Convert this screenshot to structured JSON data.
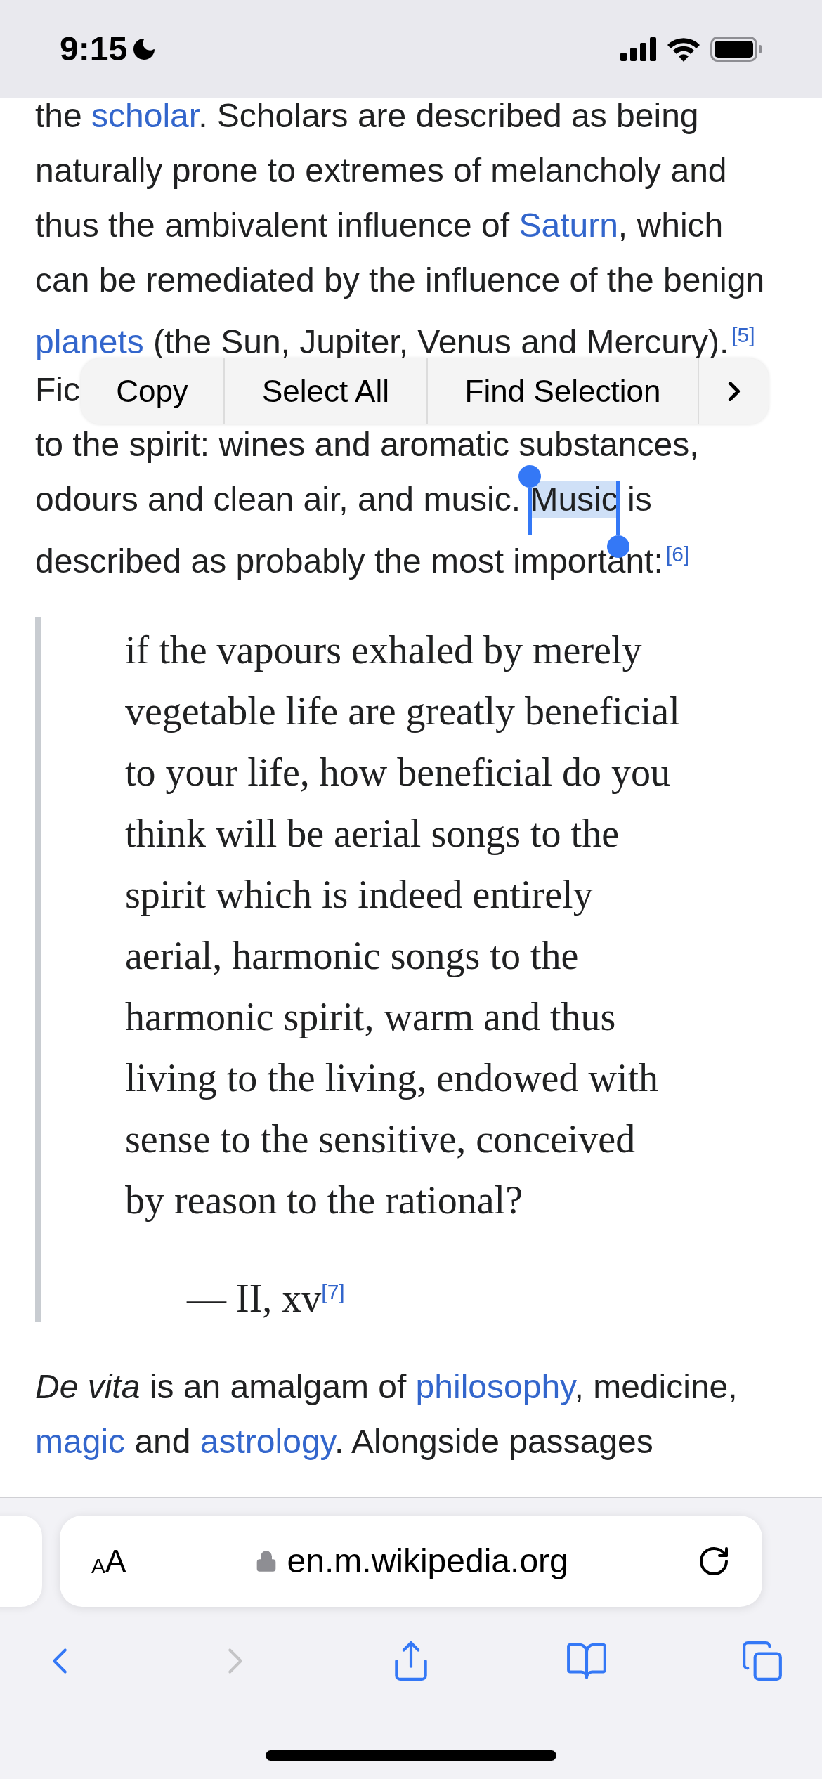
{
  "status_bar": {
    "time": "9:15"
  },
  "paragraph_1": [
    [
      {
        "kind": "text",
        "text": "the "
      },
      {
        "kind": "link",
        "text": "scholar"
      },
      {
        "kind": "text",
        "text": ". Scholars are described as being"
      }
    ],
    [
      {
        "kind": "text",
        "text": "naturally prone to extremes of melancholy and"
      }
    ],
    [
      {
        "kind": "text",
        "text": "thus the ambivalent influence of "
      },
      {
        "kind": "link",
        "text": "Saturn"
      },
      {
        "kind": "text",
        "text": ", which"
      }
    ],
    [
      {
        "kind": "text",
        "text": "can be remediated by the influence of the benign"
      }
    ],
    [
      {
        "kind": "link",
        "text": "planets"
      },
      {
        "kind": "text",
        "text": " (the Sun, Jupiter, Venus and Mercury)."
      },
      {
        "kind": "ref",
        "text": "[5]"
      }
    ],
    [
      {
        "kind": "text",
        "text": "Fic"
      }
    ],
    [
      {
        "kind": "text",
        "text": "to the spirit: wines and aromatic substances,"
      }
    ],
    [
      {
        "kind": "text",
        "text": "odours and clean air, and music. "
      },
      {
        "kind": "selected",
        "text": "Music"
      },
      {
        "kind": "text",
        "text": " is"
      }
    ],
    [
      {
        "kind": "text",
        "text": "described as probably the most important:"
      },
      {
        "kind": "ref",
        "text": "[6]"
      }
    ]
  ],
  "selection_menu": {
    "items": [
      "Copy",
      "Select All",
      "Find Selection"
    ]
  },
  "quote": {
    "lines": [
      "if the vapours exhaled by merely",
      "vegetable life are greatly beneficial",
      "to your life, how beneficial do you",
      "think will be aerial songs to the",
      "spirit which is indeed entirely",
      "aerial, harmonic songs to the",
      "harmonic spirit, warm and thus",
      "living to the living, endowed with",
      "sense to the sensitive, conceived",
      "by reason to the rational?"
    ],
    "attribution": {
      "text": "— II, xv",
      "ref": "[7]"
    }
  },
  "paragraph_2": [
    [
      {
        "kind": "italic",
        "text": "De vita"
      },
      {
        "kind": "text",
        "text": " is an amalgam of "
      },
      {
        "kind": "link",
        "text": "philosophy"
      },
      {
        "kind": "text",
        "text": ", medicine,"
      }
    ],
    [
      {
        "kind": "link",
        "text": "magic"
      },
      {
        "kind": "text",
        "text": " and "
      },
      {
        "kind": "link",
        "text": "astrology"
      },
      {
        "kind": "text",
        "text": ". Alongside passages"
      }
    ]
  ],
  "address_bar": {
    "format_letters": [
      "A",
      "A"
    ],
    "url": "en.m.wikipedia.org"
  },
  "toolbar": [
    {
      "kind": "back",
      "disabled": false
    },
    {
      "kind": "forward",
      "disabled": true
    },
    {
      "kind": "share",
      "disabled": false
    },
    {
      "kind": "bookmarks",
      "disabled": false
    },
    {
      "kind": "tabs",
      "disabled": false
    }
  ]
}
